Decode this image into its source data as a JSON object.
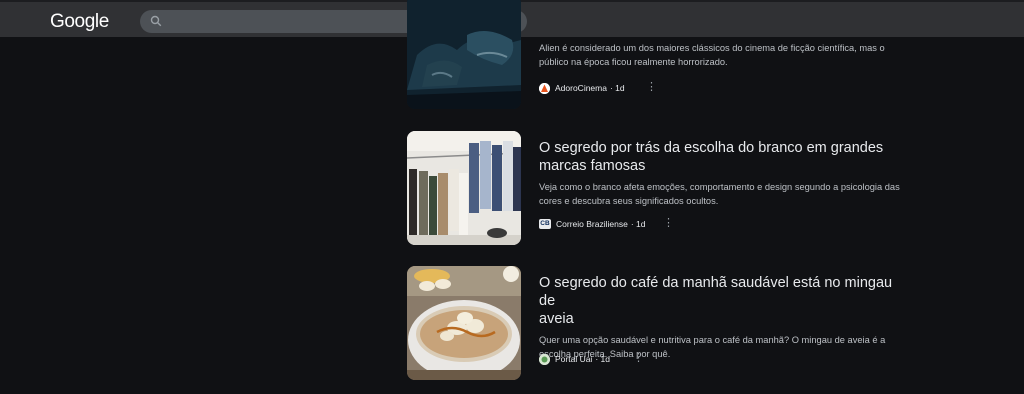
{
  "header": {
    "logo": "Google",
    "search_placeholder": "",
    "icons": [
      "search-icon",
      "mic-icon",
      "lens-icon"
    ]
  },
  "articles": [
    {
      "title": "",
      "snippet_line1": "Alien é considerado um dos maiores clássicos do cinema de ficção científica, mas o",
      "snippet_line2": "público na época ficou realmente horrorizado.",
      "source": "AdoroCinema",
      "age": "· 1d"
    },
    {
      "title_line1": "O segredo por trás da escolha do branco em grandes",
      "title_line2": "marcas famosas",
      "snippet_line1": "Veja como o branco afeta emoções, comportamento e design segundo a psicologia das",
      "snippet_line2": "cores e descubra seus significados ocultos.",
      "source": "Correio Braziliense",
      "favicon_text": "CB",
      "age": "· 1d"
    },
    {
      "title_line1": "O segredo do café da manhã saudável está no mingau de",
      "title_line2": "aveia",
      "snippet_line1": "Quer uma opção saudável e nutritiva para o café da manhã? O mingau de aveia é a",
      "snippet_line2": "escolha perfeita. Saiba por quê.",
      "source": "Portal Uai",
      "age": "· 1d"
    }
  ],
  "more_glyph": "⋮"
}
